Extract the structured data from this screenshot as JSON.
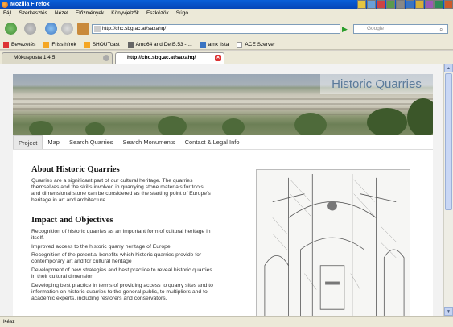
{
  "window": {
    "title": "Mozilla Firefox"
  },
  "menu": [
    "Fájl",
    "Szerkesztés",
    "Nézet",
    "Előzmények",
    "Könyvjelzők",
    "Eszközök",
    "Súgó"
  ],
  "address": {
    "url": "http://chc.sbg.ac.at/saxahq/"
  },
  "search": {
    "placeholder": "Google"
  },
  "bookmarks": [
    "Bevezetés",
    "Friss hírek",
    "SHOUTcast",
    "Amd64 and Dell5.53 - ...",
    "amx lista",
    "ACE Szerver"
  ],
  "tabs": [
    {
      "label": "Mókusposta 1.4.5"
    },
    {
      "label": "http://chc.sbg.ac.at/saxahq/"
    }
  ],
  "site": {
    "brand": "Historic Quarries",
    "nav": [
      "Project",
      "Map",
      "Search Quarries",
      "Search Monuments",
      "Contact & Legal Info"
    ],
    "about_heading": "About Historic Quarries",
    "about_text": "Quarries are a significant part of our cultural heritage. The quarries themselves and the skills involved in quarrying stone materials for tools and dimensional stone can be considered as the starting point of Europe's heritage in art and architecture.",
    "impact_heading": "Impact and Objectives",
    "objectives": [
      "Recognition of historic quarries as an important form of cultural heritage in itself.",
      "Improved access to the historic quarry heritage of Europe.",
      "Recognition of the potential benefits which historic quarries provide for contemporary art and for cultural heritage",
      "Development of new strategies and best practice to reveal historic quarries in their cultural dimension",
      "Developing best practice in terms of providing access to quarry sites and to information on historic quarries to the general public, to multipliers and to academic experts, including restorers and conservators."
    ]
  },
  "status": {
    "text": "Kész"
  },
  "colors": {
    "titlebar": "#0646b8",
    "brand_text": "#5a7a9a",
    "chrome": "#ece9d8"
  },
  "icons": [
    "firefox-icon",
    "back-icon",
    "forward-icon",
    "reload-icon",
    "stop-icon",
    "home-icon",
    "go-icon",
    "google-icon",
    "tab-close-icon"
  ]
}
